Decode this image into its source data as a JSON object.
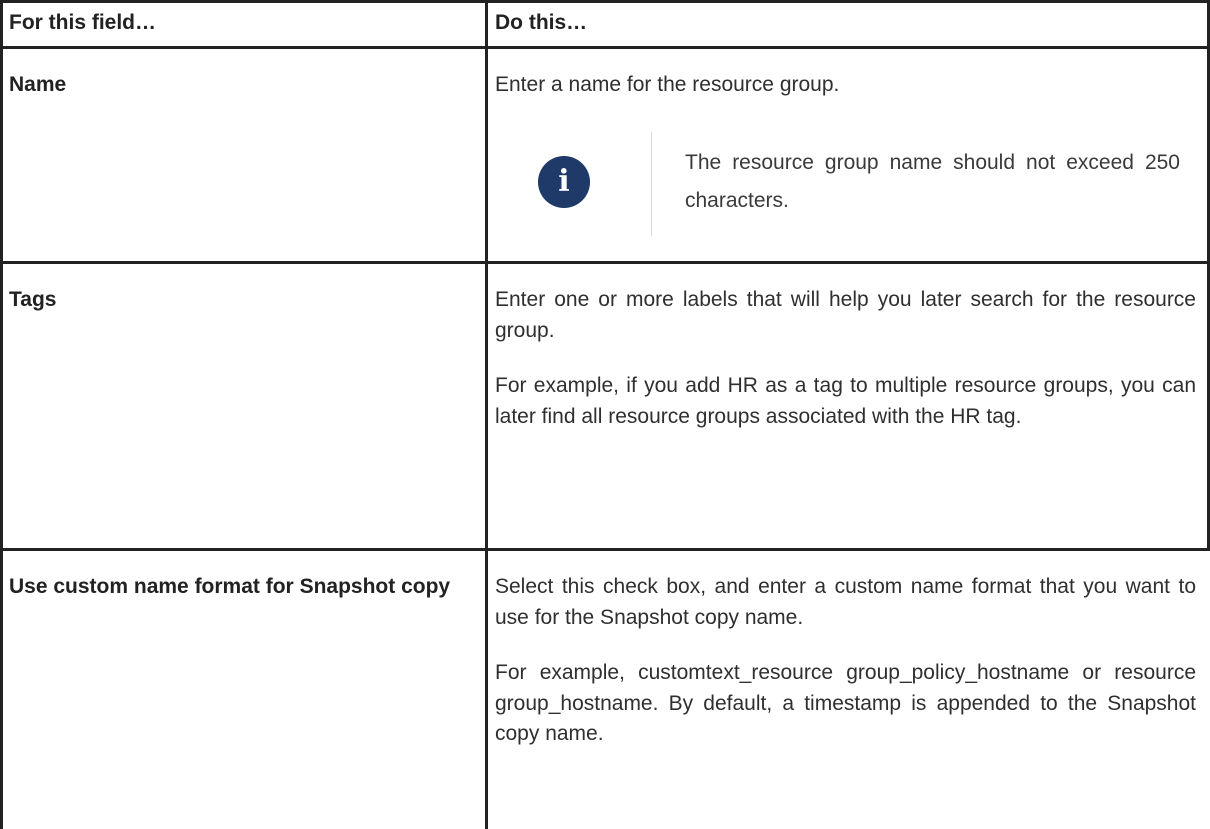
{
  "table": {
    "headers": [
      "For this field…",
      "Do this…"
    ],
    "rows": [
      {
        "field": "Name",
        "description": [
          "Enter a name for the resource group."
        ],
        "note": "The resource group name should not exceed 250 characters."
      },
      {
        "field": "Tags",
        "description": [
          "Enter one or more labels that will help you later search for the resource group.",
          "For example, if you add HR as a tag to multiple resource groups, you can later find all resource groups associated with the HR tag."
        ]
      },
      {
        "field": "Use custom name format for Snapshot copy",
        "description": [
          "Select this check box, and enter a custom name format that you want to use for the Snapshot copy name.",
          "For example, customtext_resource group_policy_hostname or resource group_hostname. By default, a timestamp is appended to the Snapshot copy name."
        ]
      }
    ]
  },
  "icons": {
    "note": "info-icon"
  },
  "colors": {
    "info_icon_bg": "#1f3a68",
    "border": "#222222"
  }
}
